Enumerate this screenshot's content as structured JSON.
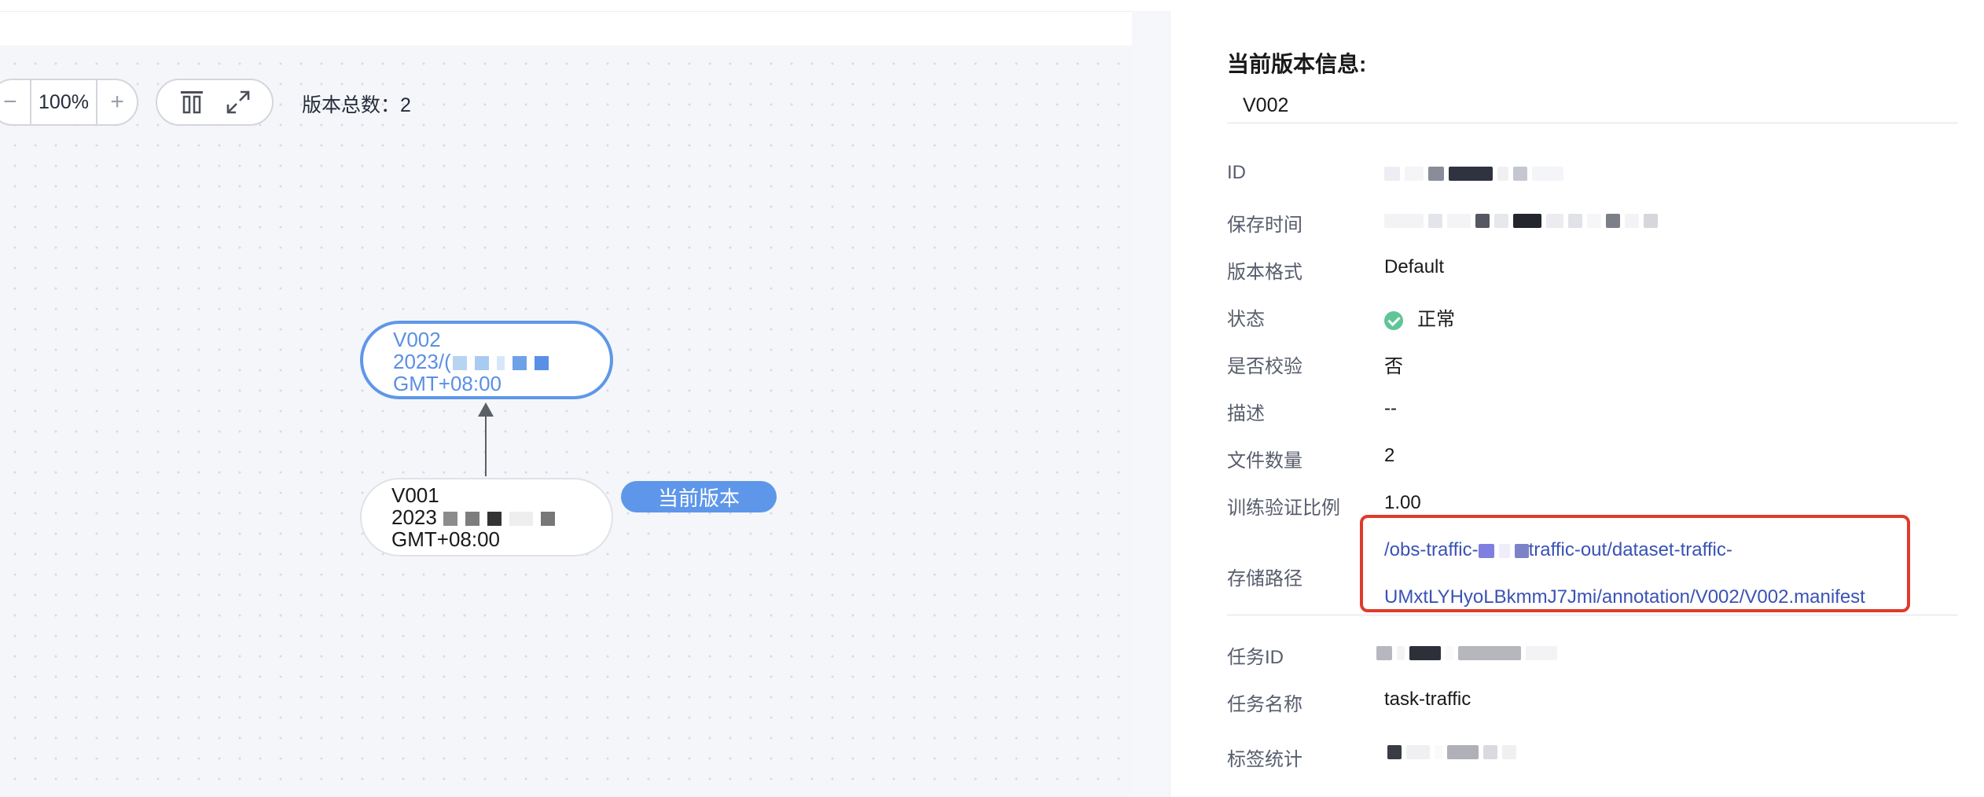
{
  "toolbar": {
    "zoom_out": "−",
    "zoom_value": "100%",
    "zoom_in": "+",
    "total_label": "版本总数：2"
  },
  "graph": {
    "active_node": {
      "line1": "V002",
      "line2": "2023/(",
      "line3": "GMT+08:00"
    },
    "other_node": {
      "line1": "V001",
      "line2": "2023",
      "line3": "GMT+08:00"
    },
    "current_tag": "当前版本"
  },
  "panel": {
    "title": "当前版本信息:",
    "version_name": "V002",
    "rows": {
      "id": {
        "label": "ID"
      },
      "save_time": {
        "label": "保存时间"
      },
      "format": {
        "label": "版本格式",
        "value": "Default"
      },
      "status": {
        "label": "状态",
        "value": "正常"
      },
      "verify": {
        "label": "是否校验",
        "value": "否"
      },
      "description": {
        "label": "描述",
        "value": "--"
      },
      "file_count": {
        "label": "文件数量",
        "value": "2"
      },
      "ratio": {
        "label": "训练验证比例",
        "value": "1.00"
      },
      "storage": {
        "label": "存储路径",
        "line1_prefix": "/obs-traffic-",
        "line1_suffix": "traffic-out/dataset-traffic-",
        "line2": "UMxtLYHyoLBkmmJ7Jmi/annotation/V002/V002.manifest"
      },
      "task_id": {
        "label": "任务ID"
      },
      "task_name": {
        "label": "任务名称",
        "value": "task-traffic"
      },
      "label_stats": {
        "label": "标签统计"
      }
    }
  },
  "colors": {
    "accent": "#5e97e9",
    "highlight_border": "#e03a2b",
    "status_ok": "#5fc596",
    "link": "#3a52b4"
  }
}
